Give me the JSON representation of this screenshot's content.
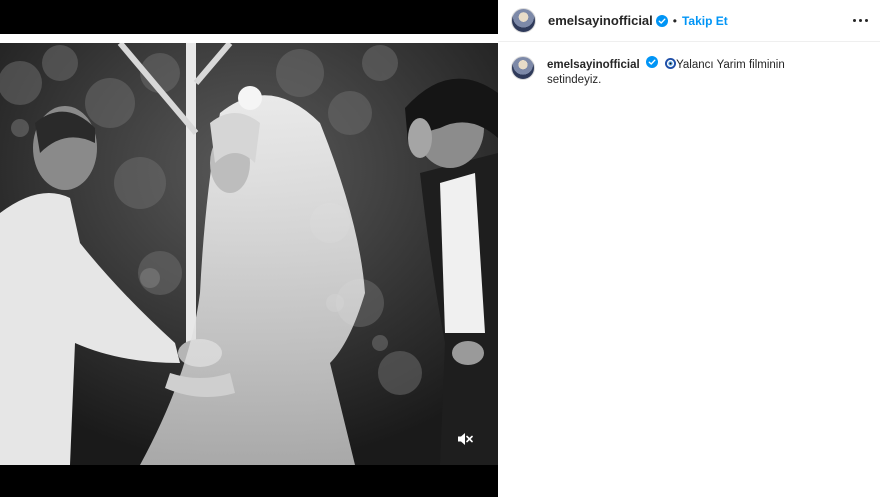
{
  "post": {
    "username": "emelsayinofficial",
    "follow_label": "Takip Et",
    "separator": "•",
    "caption_emoji_icon": "nazar-amulet-icon",
    "caption_text": "Yalancı Yarim filminin setindeyiz."
  },
  "icons": {
    "verified": "verified-badge-icon",
    "more": "more-options-icon",
    "mute": "speaker-muted-icon"
  },
  "colors": {
    "accent": "#0095f6",
    "text": "#262626",
    "border": "#efefef",
    "media_bg": "#000000"
  }
}
